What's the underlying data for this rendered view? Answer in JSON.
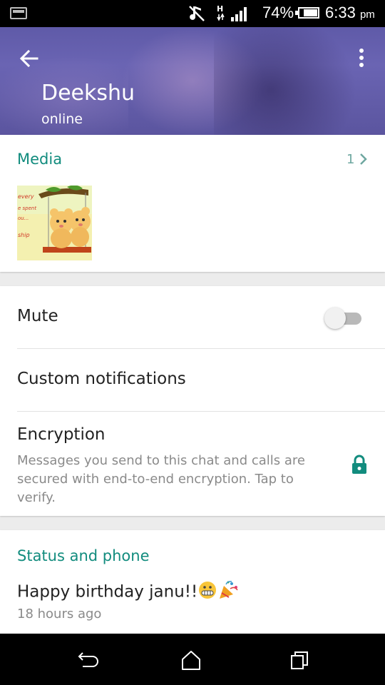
{
  "status_bar": {
    "battery_percent": "74%",
    "time": "6:33",
    "ampm": "pm",
    "network_label": "H",
    "battery_level": 0.74,
    "icons": [
      "notification-icon",
      "music-off-icon",
      "signal-icon",
      "battery-icon"
    ]
  },
  "header": {
    "contact_name": "Deekshu",
    "contact_status": "online",
    "background_tint": "#5f5aa8"
  },
  "media": {
    "title": "Media",
    "count": "1"
  },
  "settings": {
    "mute_label": "Mute",
    "mute_enabled": false,
    "custom_notifications_label": "Custom notifications",
    "encryption_label": "Encryption",
    "encryption_description": "Messages you send to this chat and calls are secured with end-to-end encryption. Tap to verify."
  },
  "status": {
    "title": "Status and phone",
    "text": "Happy birthday janu!!",
    "time": "18 hours ago"
  },
  "colors": {
    "accent": "#128c7e",
    "secondary_text": "#8a8a8a"
  }
}
